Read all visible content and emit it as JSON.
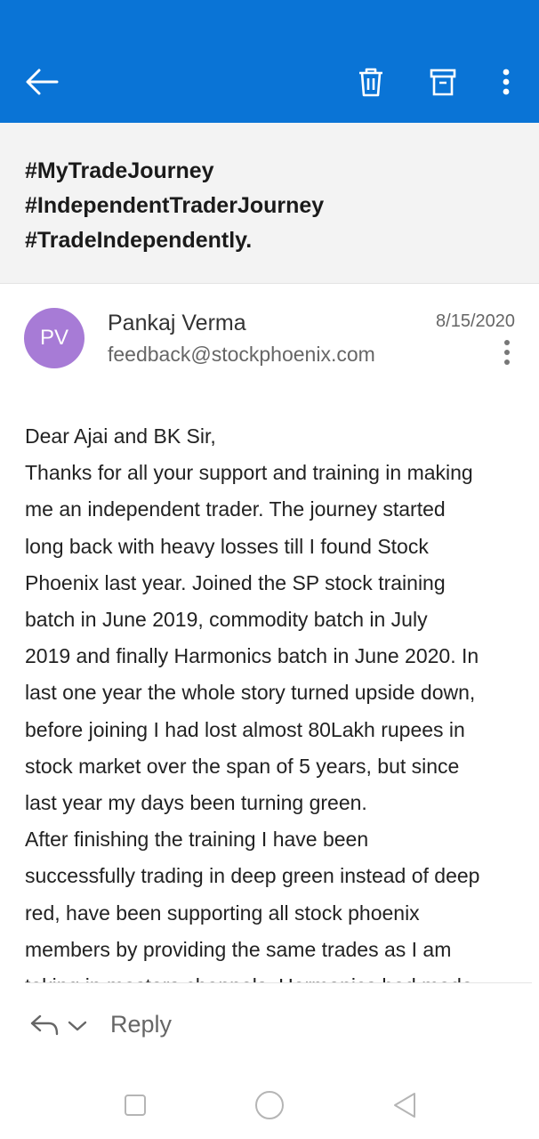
{
  "colors": {
    "accent": "#0a74d6",
    "avatar": "#a77bd6"
  },
  "toolbar": {
    "back_icon": "arrow-left-icon",
    "delete_icon": "trash-icon",
    "archive_icon": "archive-icon",
    "more_icon": "more-vertical-icon"
  },
  "subject": {
    "lines": [
      "#MyTradeJourney",
      "#IndependentTraderJourney",
      "#TradeIndependently."
    ]
  },
  "message": {
    "avatar_initials": "PV",
    "sender_name": "Pankaj Verma",
    "sender_email": "feedback@stockphoenix.com",
    "date": "8/15/2020",
    "body_lines": [
      "Dear Ajai and BK Sir,",
      "Thanks for all your support and training in making",
      "me an independent trader. The journey started",
      "long back with heavy losses till I found Stock",
      "Phoenix last year. Joined the SP stock training",
      "batch in June 2019, commodity batch in July",
      "2019 and finally Harmonics batch in June 2020. In",
      "last one year the whole story turned upside down,",
      "before joining I had lost almost 80Lakh rupees in",
      "stock market over the span of 5 years, but since",
      "last year my days been turning green.",
      "After finishing the training I have been",
      "successfully trading in deep green instead of deep",
      "red, have been supporting all stock phoenix",
      "members by providing the same trades as I am",
      "taking in masters channels. Harmonics had made"
    ]
  },
  "reply": {
    "label": "Reply"
  },
  "system_nav": {
    "recents_icon": "square-icon",
    "home_icon": "circle-icon",
    "back_icon": "triangle-back-icon"
  }
}
